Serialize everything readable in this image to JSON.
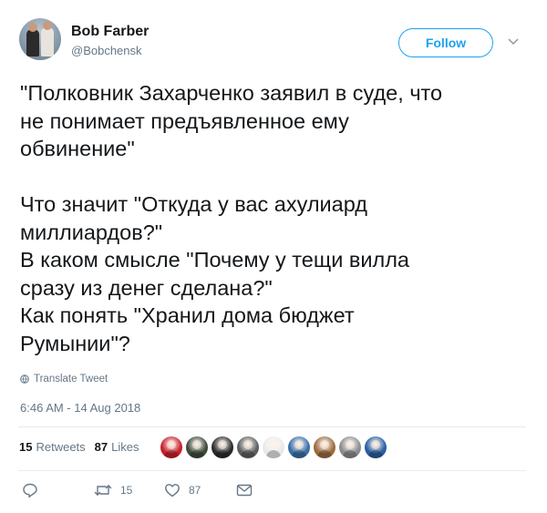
{
  "author": {
    "name": "Bob Farber",
    "handle": "@Bobchensk"
  },
  "follow_label": "Follow",
  "tweet_lines": [
    "\"Полковник Захарченко заявил в суде, что",
    "не понимает предъявленное ему",
    "обвинение\"",
    "",
    "Что значит \"Откуда у вас ахулиард",
    "миллиардов?\"",
    "В каком смысле \"Почему у тещи вилла",
    "сразу из денег сделана?\"",
    "Как понять \"Хранил дома бюджет",
    "Румынии\"?"
  ],
  "translate_label": "Translate Tweet",
  "timestamp": "6:46 AM - 14 Aug 2018",
  "stats": {
    "retweets_count": "15",
    "retweets_label": "Retweets",
    "likes_count": "87",
    "likes_label": "Likes"
  },
  "likers": [
    {
      "icon": "avatar-red",
      "color": "#c8202a"
    },
    {
      "icon": "avatar-man-beard",
      "color": "#3f4a3a"
    },
    {
      "icon": "avatar-dark-cat",
      "color": "#2b2b2b"
    },
    {
      "icon": "avatar-gray",
      "color": "#5e5e5e"
    },
    {
      "icon": "avatar-white-figure",
      "color": "#e9e9e9"
    },
    {
      "icon": "avatar-cartoon-blue",
      "color": "#3a6ea5"
    },
    {
      "icon": "avatar-bronze",
      "color": "#9c6b3f"
    },
    {
      "icon": "avatar-gray-man",
      "color": "#8c8c8c"
    },
    {
      "icon": "avatar-blue-shirt",
      "color": "#2c5d9e"
    }
  ],
  "actions": {
    "reply_count": "",
    "retweet_count": "15",
    "like_count": "87"
  },
  "colors": {
    "accent": "#1da1f2",
    "secondary_text": "#657786",
    "divider": "#e6ecf0"
  }
}
